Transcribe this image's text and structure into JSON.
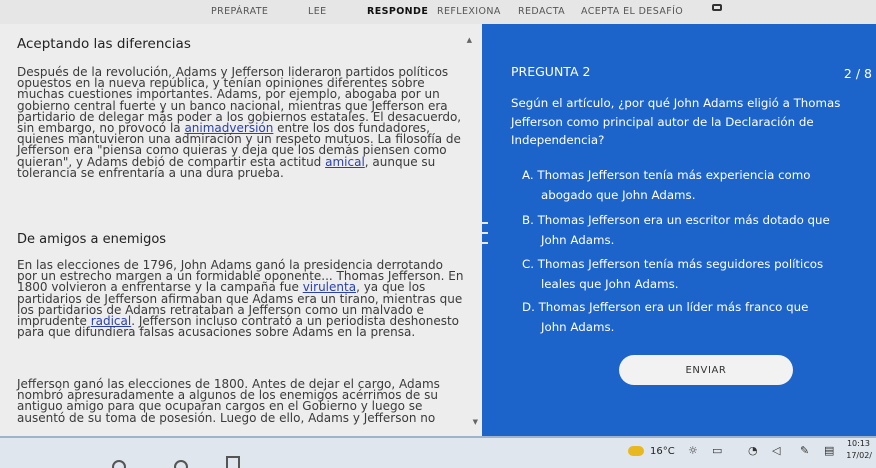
{
  "nav": {
    "items": [
      "PREPÁRATE",
      "LEE",
      "RESPONDE",
      "REFLEXIONA",
      "REDACTA",
      "ACEPTA EL DESAFÍO"
    ],
    "active": "RESPONDE"
  },
  "reading": {
    "title": "Aceptando las diferencias",
    "p1": {
      "a": "Después de la revolución, Adams y Jefferson lideraron partidos políticos opuestos en la nueva república, y tenían opiniones diferentes sobre muchas cuestiones importantes. Adams, por ejemplo, abogaba por un gobierno central fuerte y un banco nacional, mientras que Jefferson era partidario de delegar más poder a los gobiernos estatales. El desacuerdo, sin embargo, no provocó la ",
      "link1": "animadversión",
      "b": " entre los dos fundadores, quienes mantuvieron una admiración y un respeto mutuos. La filosofía de Jefferson era \"piensa como quieras y deja que los demás piensen como quieran\", y Adams debió de compartir esta actitud ",
      "link2": "amical",
      "c": ", aunque su tolerancia se enfrentaría a una dura prueba."
    },
    "subtitle": "De amigos a enemigos",
    "p2": {
      "a": "En las elecciones de 1796, John Adams ganó la presidencia derrotando por un estrecho margen a un formidable oponente... Thomas Jefferson. En 1800 volvieron a enfrentarse y la campaña fue ",
      "link1": "virulenta",
      "b": ", ya que los partidarios de Jefferson afirmaban que Adams era un tirano, mientras que los partidarios de Adams retrataban a Jefferson como un malvado e imprudente ",
      "link2": "radical",
      "c": ". Jefferson incluso contrató a un periodista deshonesto para que difundiera falsas acusaciones sobre Adams en la prensa."
    },
    "p3": "Jefferson ganó las elecciones de 1800. Antes de dejar el cargo, Adams nombró apresuradamente a algunos de los enemigos acérrimos de su antiguo amigo para que ocuparan cargos en el Gobierno y luego se ausentó de su toma de posesión. Luego de ello, Adams y Jefferson no"
  },
  "question": {
    "label": "PREGUNTA 2",
    "count": "2 / 8",
    "text": "Según el artículo, ¿por qué John Adams eligió a Thomas Jefferson como principal autor de la Declaración de Independencia?",
    "options": [
      {
        "letter": "A.",
        "line1": "Thomas Jefferson tenía más experiencia como",
        "line2": "abogado que John Adams."
      },
      {
        "letter": "B.",
        "line1": "Thomas Jefferson era un escritor más dotado que",
        "line2": "John Adams."
      },
      {
        "letter": "C.",
        "line1": "Thomas Jefferson tenía más seguidores políticos",
        "line2": "leales que John Adams."
      },
      {
        "letter": "D.",
        "line1": "Thomas Jefferson era un líder más franco que",
        "line2": "John Adams."
      }
    ],
    "submit_label": "ENVIAR"
  },
  "taskbar": {
    "temperature": "16°C",
    "time": "10:13",
    "date": "17/02/"
  },
  "colors": {
    "question_bg": "#1c64c9",
    "reading_bg": "#ededed",
    "link": "#2a3fb0"
  }
}
